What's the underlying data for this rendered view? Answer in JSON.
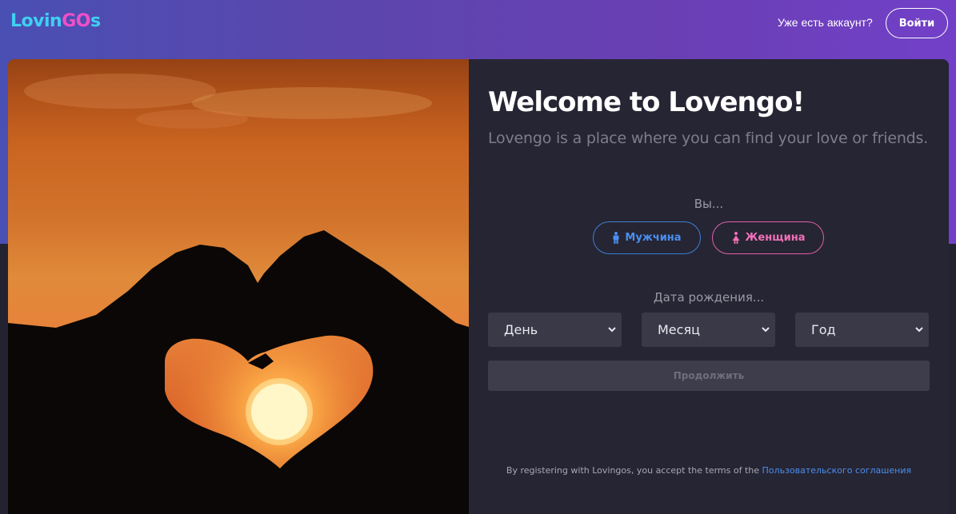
{
  "header": {
    "logo": {
      "part1": "Lovin",
      "part2": "GO",
      "part3": "s"
    },
    "have_account_text": "Уже есть аккаунт?",
    "login_label": "Войти"
  },
  "hero": {
    "image_alt": "Silhouette of hands forming a heart around the setting sun"
  },
  "signup": {
    "title": "Welcome to Lovengo!",
    "subtitle": "Lovengo is a place where you can find your love or friends.",
    "you_label": "Вы...",
    "male_label": "Мужчина",
    "female_label": "Женщина",
    "dob_label": "Дата рождения...",
    "day_placeholder": "День",
    "month_placeholder": "Месяц",
    "year_placeholder": "Год",
    "continue_label": "Продолжить",
    "terms_text": "By registering with Lovingos, you accept the terms of the",
    "terms_link": "Пользовательского соглашения"
  },
  "colors": {
    "male_accent": "#4a8ef0",
    "female_accent": "#f070b8",
    "panel_bg": "#262533",
    "link": "#4a8ef0"
  },
  "icons": {
    "male": "male-person-icon",
    "female": "female-person-icon",
    "select_chevron": "chevron-down-icon"
  }
}
